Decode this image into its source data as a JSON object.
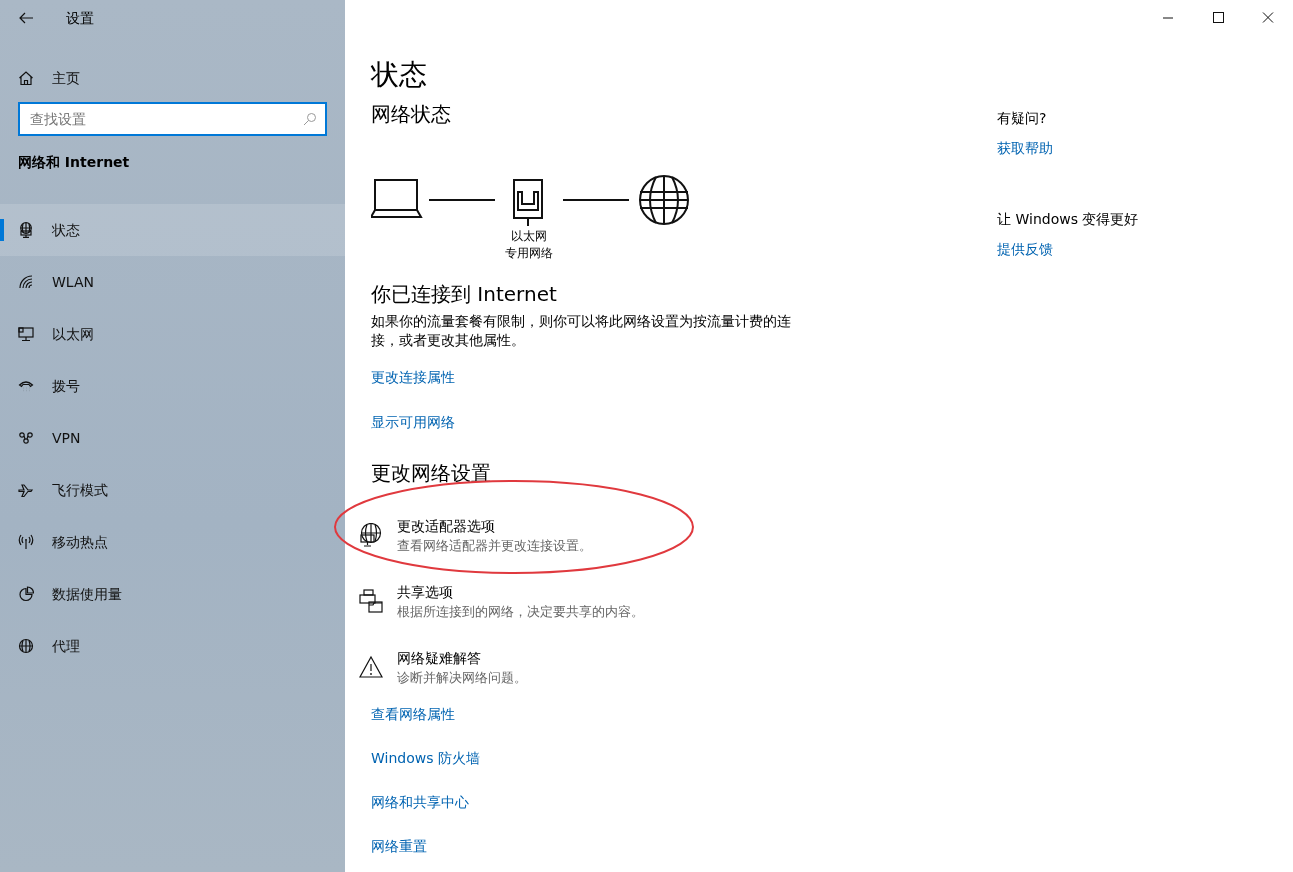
{
  "window": {
    "title": "设置"
  },
  "sidebar": {
    "home": "主页",
    "search": {
      "placeholder": "查找设置"
    },
    "section": "网络和 Internet",
    "items": [
      {
        "label": "状态",
        "kind": "status",
        "selected": true
      },
      {
        "label": "WLAN",
        "kind": "wifi",
        "selected": false
      },
      {
        "label": "以太网",
        "kind": "ethernet",
        "selected": false
      },
      {
        "label": "拨号",
        "kind": "dialup",
        "selected": false
      },
      {
        "label": "VPN",
        "kind": "vpn",
        "selected": false
      },
      {
        "label": "飞行模式",
        "kind": "airplane",
        "selected": false
      },
      {
        "label": "移动热点",
        "kind": "hotspot",
        "selected": false
      },
      {
        "label": "数据使用量",
        "kind": "data",
        "selected": false
      },
      {
        "label": "代理",
        "kind": "globe",
        "selected": false
      }
    ]
  },
  "main": {
    "title": "状态",
    "network_heading": "网络状态",
    "diagram_labels": [
      "以太网",
      "专用网络"
    ],
    "connected_heading": "你已连接到 Internet",
    "connected_text": "如果你的流量套餐有限制，则你可以将此网络设置为按流量计费的连接，或者更改其他属性。",
    "links": [
      "更改连接属性",
      "显示可用网络"
    ],
    "change_heading": "更改网络设置",
    "options": [
      {
        "kind": "adapter",
        "title": "更改适配器选项",
        "description": "查看网络适配器并更改连接设置。"
      },
      {
        "kind": "sharing",
        "title": "共享选项",
        "description": "根据所连接到的网络，决定要共享的内容。"
      },
      {
        "kind": "warning",
        "title": "网络疑难解答",
        "description": "诊断并解决网络问题。"
      }
    ],
    "bottom_links": [
      "查看网络属性",
      "Windows 防火墙",
      "网络和共享中心",
      "网络重置"
    ]
  },
  "aside": [
    {
      "heading": "有疑问?",
      "link": "获取帮助"
    },
    {
      "heading": "让 Windows 变得更好",
      "link": "提供反馈"
    }
  ],
  "annotation": {
    "kind": "ellipse",
    "color": "#e0393e"
  }
}
